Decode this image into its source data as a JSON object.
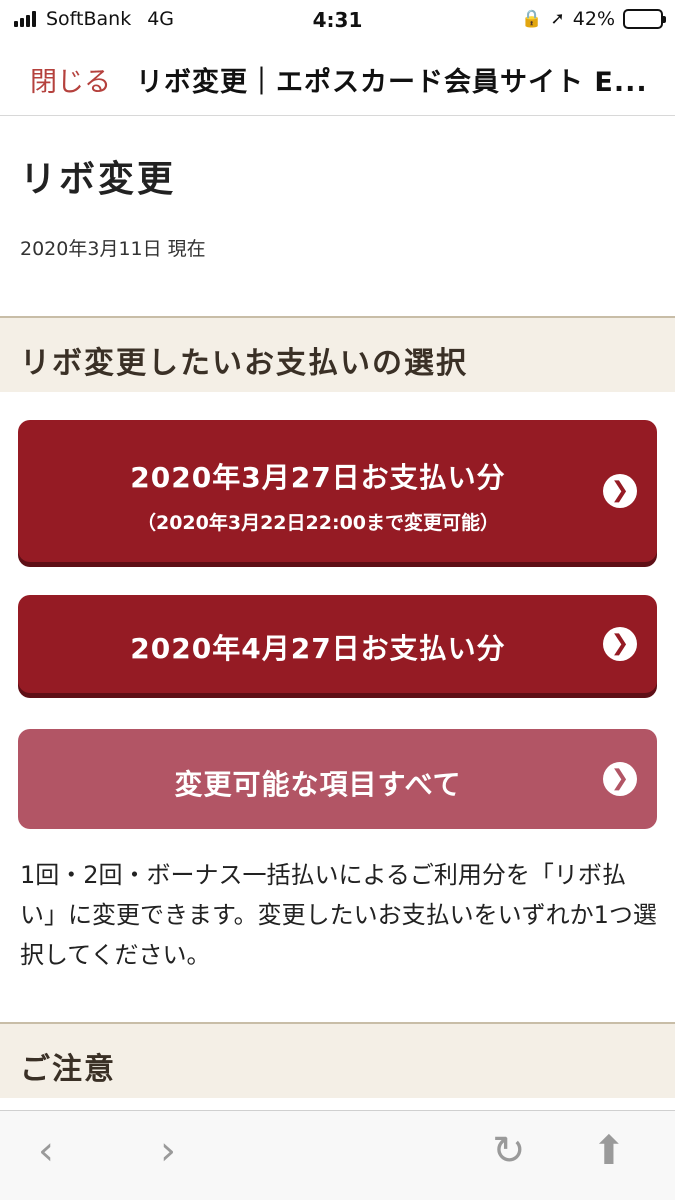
{
  "status_bar": {
    "carrier": "SoftBank",
    "network": "4G",
    "time": "4:31",
    "battery": "42%",
    "battery_level": 0.42
  },
  "nav": {
    "close_label": "閉じる",
    "title": "リボ変更｜エポスカード会員サイト E..."
  },
  "page": {
    "title": "リボ変更",
    "as_of": "2020年3月11日 現在"
  },
  "selection": {
    "header": "リボ変更したいお支払いの選択",
    "options": [
      {
        "label": "2020年3月27日お支払い分",
        "sub": "（2020年3月22日22:00まで変更可能）"
      },
      {
        "label": "2020年4月27日お支払い分"
      },
      {
        "label": "変更可能な項目すべて"
      }
    ],
    "description": "1回・2回・ボーナス一括払いによるご利用分を「リボ払い」に変更できます。変更したいお支払いをいずれか1つ選択してください。"
  },
  "notice": {
    "header": "ご注意"
  },
  "icons": {
    "signal": "signal-icon",
    "lock_rotation": "orientation-lock-icon",
    "location": "location-icon",
    "battery": "battery-icon",
    "chevron": "chevron-right-icon",
    "back": "back-icon",
    "forward": "forward-icon",
    "reload": "reload-icon",
    "share": "share-icon"
  },
  "colors": {
    "accent_dark": "#951b24",
    "accent_light": "#b25565",
    "close_link": "#b5413d",
    "section_bg": "#f4efe6"
  }
}
